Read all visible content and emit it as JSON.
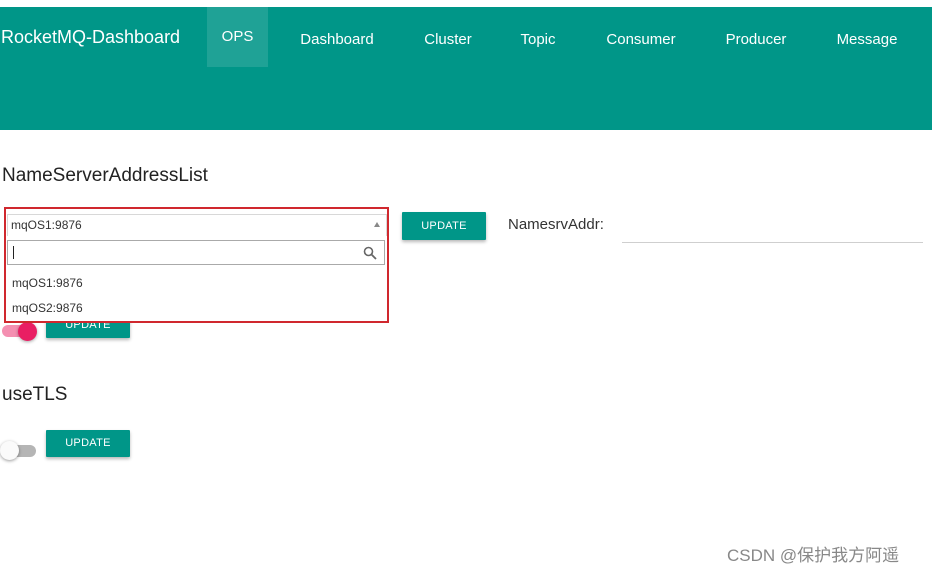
{
  "header": {
    "brand": "RocketMQ-Dashboard",
    "nav": [
      {
        "label": "OPS",
        "active": true
      },
      {
        "label": "Dashboard"
      },
      {
        "label": "Cluster"
      },
      {
        "label": "Topic"
      },
      {
        "label": "Consumer"
      },
      {
        "label": "Producer"
      },
      {
        "label": "Message"
      }
    ]
  },
  "nameserver": {
    "title": "NameServerAddressList",
    "selected": "mqOS1:9876",
    "search_value": "",
    "options": [
      "mqOS1:9876",
      "mqOS2:9876"
    ],
    "update_label": "UPDATE",
    "namesrv_label": "NamesrvAddr:",
    "namesrv_value": ""
  },
  "vip_channel": {
    "update_label": "UPDATE",
    "enabled": true
  },
  "use_tls": {
    "title": "useTLS",
    "update_label": "UPDATE",
    "enabled": false
  },
  "watermark": "CSDN @保护我方阿遥",
  "colors": {
    "primary": "#009688",
    "toggle_on": "#e91e63",
    "highlight_frame": "#d0282e"
  }
}
